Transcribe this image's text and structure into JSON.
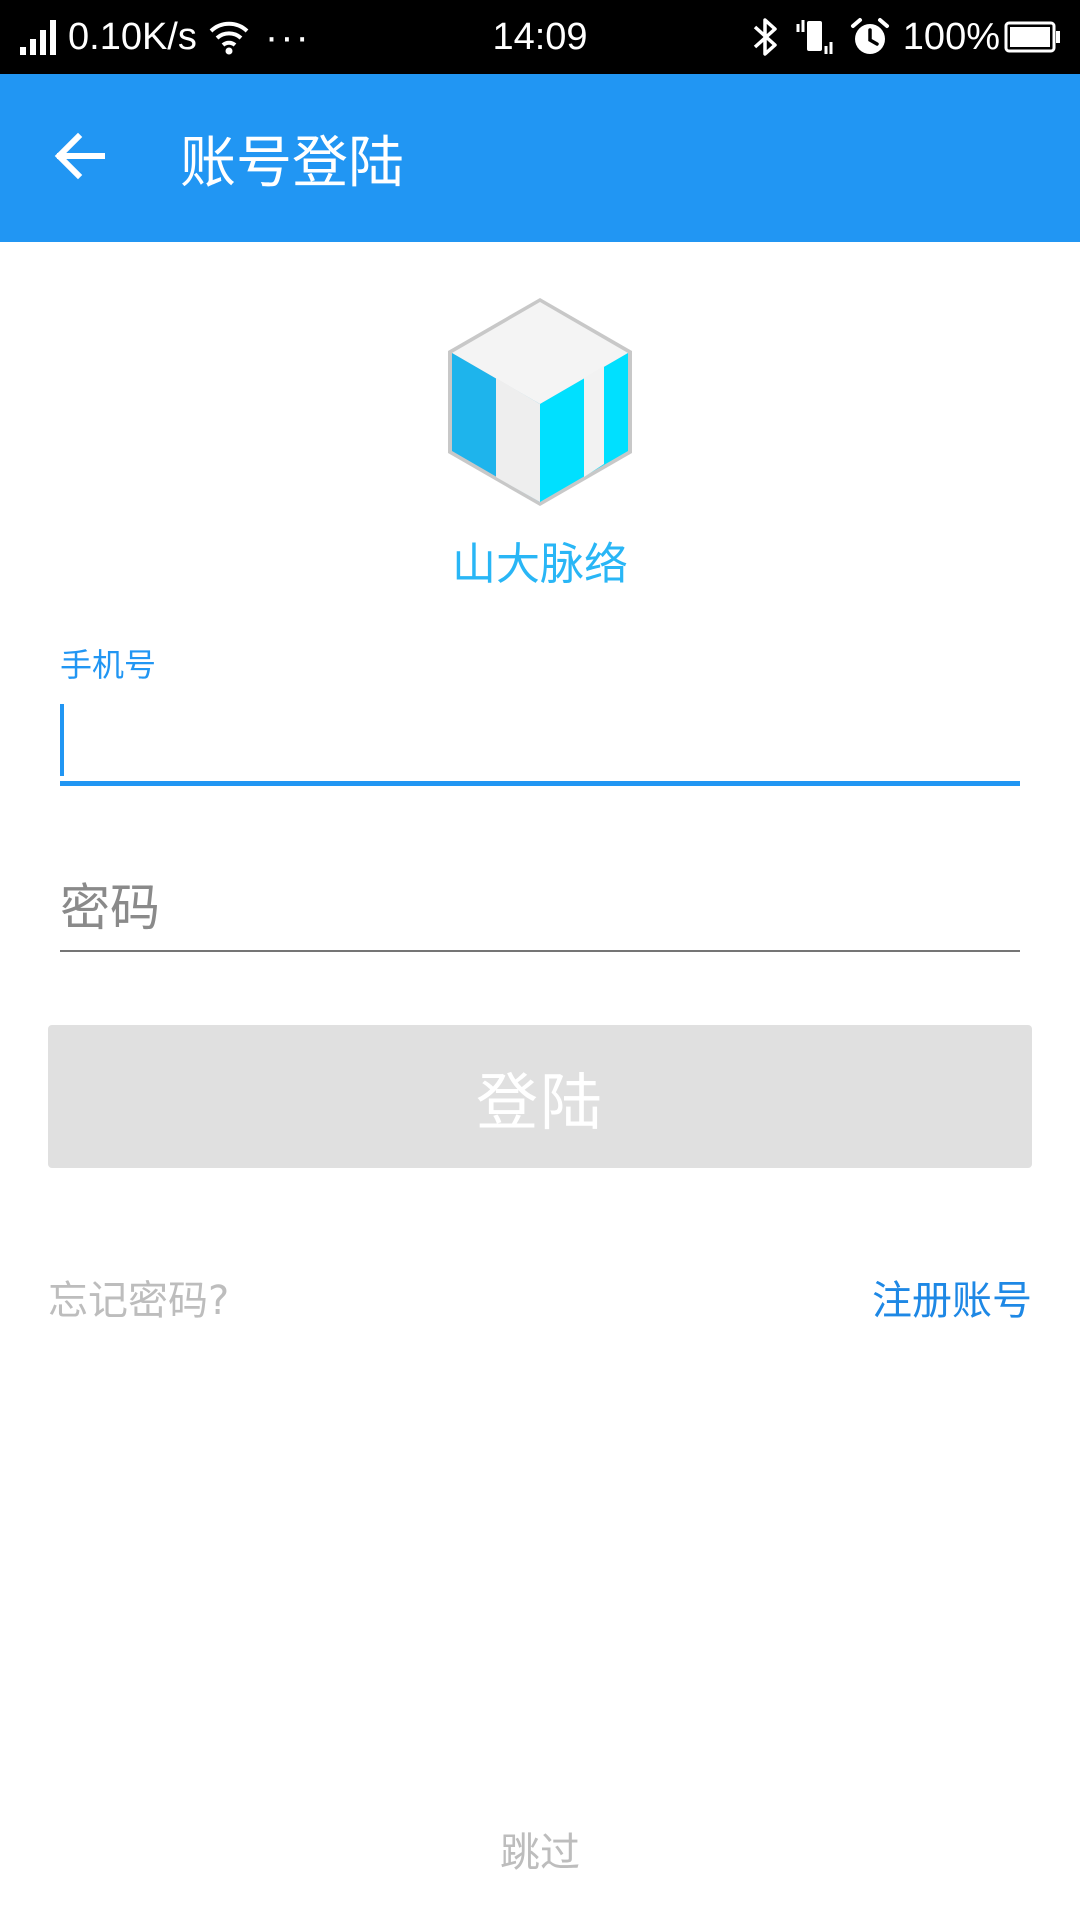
{
  "status_bar": {
    "speed": "0.10K/s",
    "more": "···",
    "time": "14:09",
    "battery": "100%",
    "icons": [
      "signal-icon",
      "wifi-icon",
      "bluetooth-icon",
      "vibrate-icon",
      "alarm-icon",
      "battery-icon"
    ]
  },
  "app_bar": {
    "back_icon": "arrow-left-icon",
    "title": "账号登陆"
  },
  "logo": {
    "caption": "山大脉络",
    "colors": {
      "face_left": "#1eb4ec",
      "face_right": "#00e0ff",
      "inner": "#eeeeee",
      "top": "#f4f4f4",
      "edge": "#c8c8c8"
    }
  },
  "form": {
    "phone_label": "手机号",
    "phone_value": "",
    "password_placeholder": "密码",
    "login_button": "登陆"
  },
  "links": {
    "forgot_password": "忘记密码?",
    "register": "注册账号",
    "skip": "跳过"
  },
  "colors": {
    "primary": "#2196f3",
    "status_bar": "#000000",
    "button_disabled": "#e0e0e0",
    "link_muted": "#bdbdbd",
    "link_accent": "#1e88e5"
  }
}
